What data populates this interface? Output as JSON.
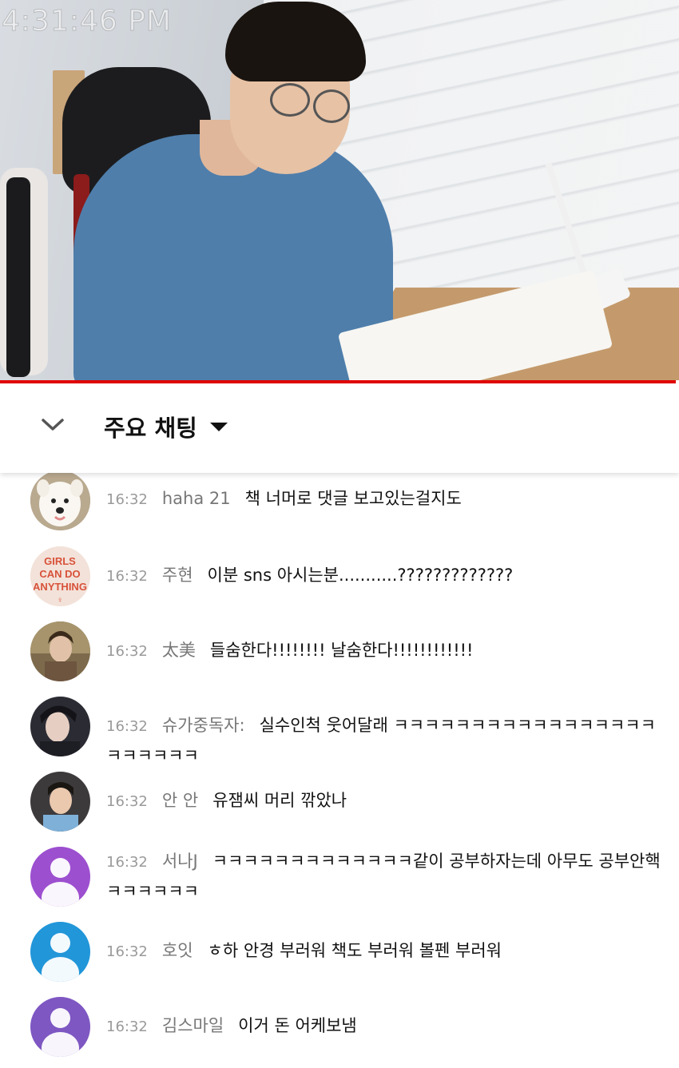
{
  "video": {
    "clock": "4:31:46 PM"
  },
  "chat": {
    "title": "주요 채팅",
    "messages": [
      {
        "time": "16:32",
        "author": "haha 21",
        "text": "책 너머로 댓글 보고있는걸지도",
        "avatar": "samoyed-dog-photo"
      },
      {
        "time": "16:32",
        "author": "주현",
        "text": "이분 sns 아시는분...........?????????????",
        "avatar": "girls-can-do-anything-text",
        "avatar_text": "GIRLS CAN DO ANYTHING"
      },
      {
        "time": "16:32",
        "author": "太美",
        "text": "들숨한다!!!!!!!! 날숨한다!!!!!!!!!!!!",
        "avatar": "person-photo"
      },
      {
        "time": "16:32",
        "author": "슈가중독자:",
        "text": "실수인척 웃어달래 ㅋㅋㅋㅋㅋㅋㅋㅋㅋㅋㅋㅋㅋㅋㅋㅋㅋㅋㅋㅋㅋㅋㅋ",
        "avatar": "person-photo"
      },
      {
        "time": "16:32",
        "author": "안 안",
        "text": "유잼씨 머리 깎았나",
        "avatar": "person-photo"
      },
      {
        "time": "16:32",
        "author": "서나J",
        "text": "ㅋㅋㅋㅋㅋㅋㅋㅋㅋㅋㅋㅋㅋ같이 공부하자는데 아무도 공부안핵ㅋㅋㅋㅋㅋㅋ",
        "avatar": "default-user-icon",
        "avatar_color": "#9c4fcf"
      },
      {
        "time": "16:32",
        "author": "호잇",
        "text": "ㅎ하 안경 부러워 책도 부러워 볼펜 부러워",
        "avatar": "default-user-icon",
        "avatar_color": "#2196d9"
      },
      {
        "time": "16:32",
        "author": "김스마일",
        "text": "이거 돈 어케보냄",
        "avatar": "default-user-icon",
        "avatar_color": "#7e57c2"
      }
    ]
  },
  "colors": {
    "progress": "#e20000",
    "time": "#9a9a9a",
    "author": "#777777"
  }
}
